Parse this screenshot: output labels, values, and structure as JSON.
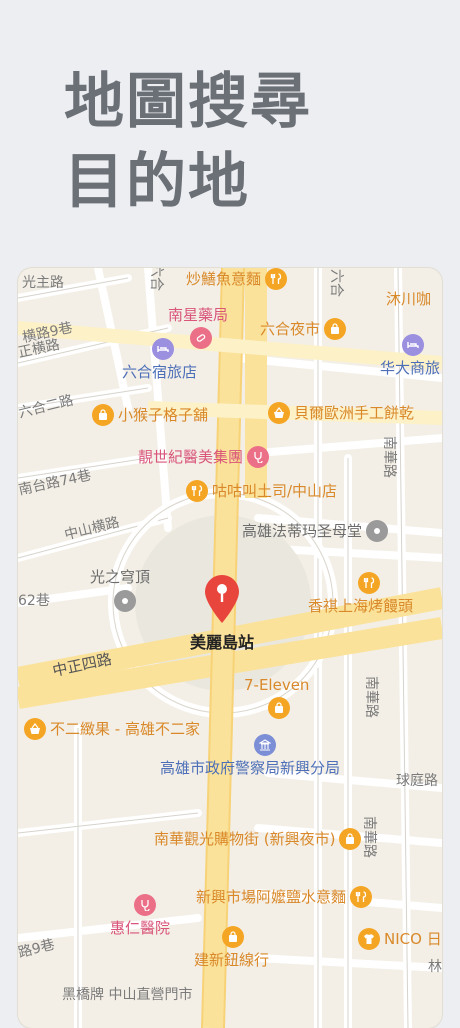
{
  "headline": {
    "line1": "地圖搜尋",
    "line2": "目的地"
  },
  "selected": {
    "name": "美麗島站",
    "color": "#e8453c"
  },
  "pois": [
    {
      "name": "炒鱔魚意麵",
      "icon": "fork-knife-icon",
      "color": "#f5a524"
    },
    {
      "name": "沐川咖",
      "icon": "fork-knife-icon",
      "color": "#f5a524"
    },
    {
      "name": "南星藥局",
      "icon": "pill-icon",
      "color": "#ec6f88"
    },
    {
      "name": "六合夜市",
      "icon": "shopping-bag-icon",
      "color": "#f5a524"
    },
    {
      "name": "六合宿旅店",
      "icon": "bed-icon",
      "color": "#9b8fe0"
    },
    {
      "name": "华大商旅",
      "icon": "bed-icon",
      "color": "#9b8fe0"
    },
    {
      "name": "小猴子格子舖",
      "icon": "shopping-bag-icon",
      "color": "#f5a524"
    },
    {
      "name": "貝爾歐洲手工餅乾",
      "icon": "basket-icon",
      "color": "#f5a524"
    },
    {
      "name": "靚世紀醫美集團",
      "icon": "stethoscope-icon",
      "color": "#ec6f88"
    },
    {
      "name": "咕咕叫土司/中山店",
      "icon": "fork-knife-icon",
      "color": "#f5a524"
    },
    {
      "name": "高雄法蒂玛圣母堂",
      "icon": "place-icon",
      "color": "#9a9a9a"
    },
    {
      "name": "光之穹頂",
      "icon": "place-icon",
      "color": "#9a9a9a"
    },
    {
      "name": "香祺上海烤饅頭",
      "icon": "fork-knife-icon",
      "color": "#f5a524"
    },
    {
      "name": "7-Eleven",
      "icon": "shopping-bag-icon",
      "color": "#f5a524"
    },
    {
      "name": "不二緻果 - 高雄不二家",
      "icon": "basket-icon",
      "color": "#f5a524"
    },
    {
      "name": "高雄市政府警察局新興分局",
      "icon": "police-icon",
      "color": "#7c8fd6"
    },
    {
      "name": "南華觀光購物街 (新興夜市)",
      "icon": "shopping-bag-icon",
      "color": "#f5a524"
    },
    {
      "name": "新興市場阿嬤鹽水意麵",
      "icon": "fork-knife-icon",
      "color": "#f5a524"
    },
    {
      "name": "惠仁醫院",
      "icon": "stethoscope-icon",
      "color": "#ec6f88"
    },
    {
      "name": "NICO 日",
      "icon": "shirt-icon",
      "color": "#f5a524"
    },
    {
      "name": "建新鈕線行",
      "icon": "shopping-bag-icon",
      "color": "#f5a524"
    }
  ],
  "streets": [
    "光主路",
    "六合",
    "六合",
    "横路9巷",
    "正横路",
    "六合二路",
    "南台路74巷",
    "中山横路",
    "62巷",
    "中正四路",
    "南華路",
    "南華路",
    "球庭路",
    "南華路",
    "路9巷",
    "林",
    "黑橋牌 中山直營門市"
  ]
}
